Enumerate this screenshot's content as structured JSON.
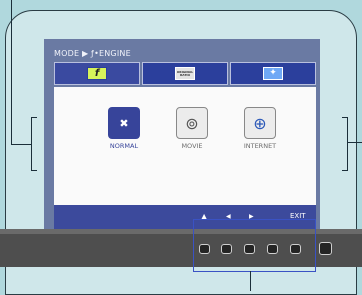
{
  "osd": {
    "header": "MODE ▶ ƒ•ENGINE",
    "tabs": [
      {
        "name": "f-engine",
        "glyph": "f"
      },
      {
        "name": "original-ratio",
        "glyph": "ORIGINAL RATIO"
      },
      {
        "name": "multimedia",
        "glyph": "✦"
      }
    ],
    "options": [
      {
        "label": "NORMAL",
        "icon": "x-icon",
        "glyph": "✖",
        "selected": true
      },
      {
        "label": "MOVIE",
        "icon": "film-reel-icon",
        "glyph": "⊚",
        "selected": false
      },
      {
        "label": "INTERNET",
        "icon": "globe-icon",
        "glyph": "⊕",
        "selected": false
      }
    ],
    "footer": {
      "up": "▲",
      "left": "◀",
      "right": "▶",
      "exit": "EXIT"
    }
  },
  "colors": {
    "background": "#b0d8dd",
    "osd_frame": "#6a7aa3",
    "tab_blue": "#2b3f9c",
    "footer_blue": "#3c4a9c",
    "highlight_box": "#3a52c4",
    "bezel": "#4e4e4e"
  }
}
